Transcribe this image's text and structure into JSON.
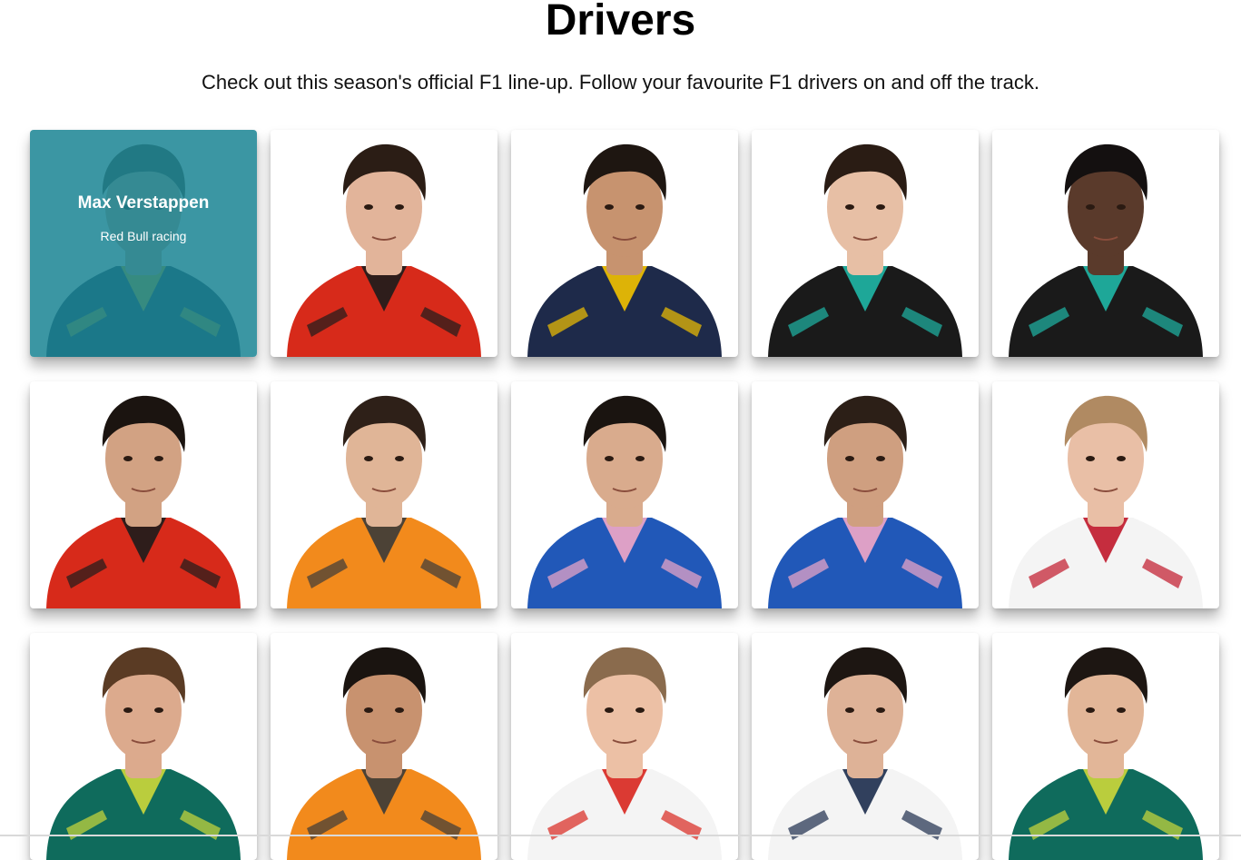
{
  "page": {
    "title": "Drivers",
    "subtitle": "Check out this season's official F1 line-up. Follow your favourite F1 drivers on and off the track."
  },
  "colors": {
    "overlay": "#1b8594",
    "background": "#ffffff"
  },
  "drivers": [
    {
      "name": "Max Verstappen",
      "team": "Red Bull racing",
      "hovered": true,
      "hair": "#4a3526",
      "skin": "#d6a98c",
      "suit": "#1e2a4a",
      "accent": "#f2c200"
    },
    {
      "name": "",
      "team": "",
      "hovered": false,
      "hair": "#2b1d15",
      "skin": "#e2b49a",
      "suit": "#d72a1a",
      "accent": "#1c1c1c"
    },
    {
      "name": "",
      "team": "",
      "hovered": false,
      "hair": "#1e1611",
      "skin": "#c7936f",
      "suit": "#1e2a4a",
      "accent": "#f2c200"
    },
    {
      "name": "",
      "team": "",
      "hovered": false,
      "hair": "#2a1c14",
      "skin": "#e7bfa5",
      "suit": "#1a1a1a",
      "accent": "#1fb7a6"
    },
    {
      "name": "",
      "team": "",
      "hovered": false,
      "hair": "#141010",
      "skin": "#5a3a2b",
      "suit": "#1a1a1a",
      "accent": "#1fb7a6"
    },
    {
      "name": "",
      "team": "",
      "hovered": false,
      "hair": "#1b1410",
      "skin": "#d2a283",
      "suit": "#d72a1a",
      "accent": "#1c1c1c"
    },
    {
      "name": "",
      "team": "",
      "hovered": false,
      "hair": "#2e2018",
      "skin": "#e0b597",
      "suit": "#f28a1c",
      "accent": "#3a3a3a"
    },
    {
      "name": "",
      "team": "",
      "hovered": false,
      "hair": "#1a1410",
      "skin": "#d9ab8d",
      "suit": "#2158b8",
      "accent": "#f2a8c8"
    },
    {
      "name": "",
      "team": "",
      "hovered": false,
      "hair": "#2c1f17",
      "skin": "#cf9f80",
      "suit": "#2158b8",
      "accent": "#f2a8c8"
    },
    {
      "name": "",
      "team": "",
      "hovered": false,
      "hair": "#b08a62",
      "skin": "#e9bfa6",
      "suit": "#f4f4f4",
      "accent": "#c0172a"
    },
    {
      "name": "",
      "team": "",
      "hovered": false,
      "hair": "#5a3b24",
      "skin": "#dcaa8d",
      "suit": "#0f6b5c",
      "accent": "#cdd83a"
    },
    {
      "name": "",
      "team": "",
      "hovered": false,
      "hair": "#1a1410",
      "skin": "#c8926f",
      "suit": "#f28a1c",
      "accent": "#3a3a3a"
    },
    {
      "name": "",
      "team": "",
      "hovered": false,
      "hair": "#8a6b4d",
      "skin": "#ecc0a5",
      "suit": "#f4f4f4",
      "accent": "#d8261e"
    },
    {
      "name": "",
      "team": "",
      "hovered": false,
      "hair": "#1d1612",
      "skin": "#deb297",
      "suit": "#f4f4f4",
      "accent": "#1c2c4c"
    },
    {
      "name": "",
      "team": "",
      "hovered": false,
      "hair": "#1d1612",
      "skin": "#e2b698",
      "suit": "#0f6b5c",
      "accent": "#cdd83a"
    }
  ]
}
